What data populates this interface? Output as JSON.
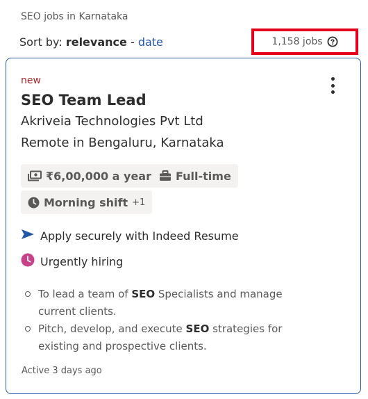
{
  "breadcrumb": "SEO jobs in Karnataka",
  "sort": {
    "prefix": "Sort by: ",
    "active": "relevance",
    "separator": " - ",
    "alternate": "date"
  },
  "job_count": "1,158 jobs",
  "card": {
    "badge": "new",
    "title": "SEO Team Lead",
    "company": "Akriveia Technologies Pvt Ltd",
    "location": "Remote in Bengaluru, Karnataka",
    "chips": {
      "salary": "₹6,00,000 a year",
      "job_type": "Full-time",
      "shift": "Morning shift",
      "shift_more": "+1"
    },
    "apply_text": "Apply securely with Indeed Resume",
    "urgent_text": "Urgently hiring",
    "snippet": [
      {
        "pre": "To lead a team of ",
        "bold": "SEO",
        "post": " Specialists and manage current clients."
      },
      {
        "pre": "Pitch, develop, and execute ",
        "bold": "SEO",
        "post": " strategies for existing and prospective clients."
      }
    ],
    "posted": "Active 3 days ago"
  },
  "colors": {
    "link": "#2557a7",
    "new_badge": "#a9252b",
    "highlight_box": "#e4001b",
    "urgent_icon": "#c74289"
  }
}
